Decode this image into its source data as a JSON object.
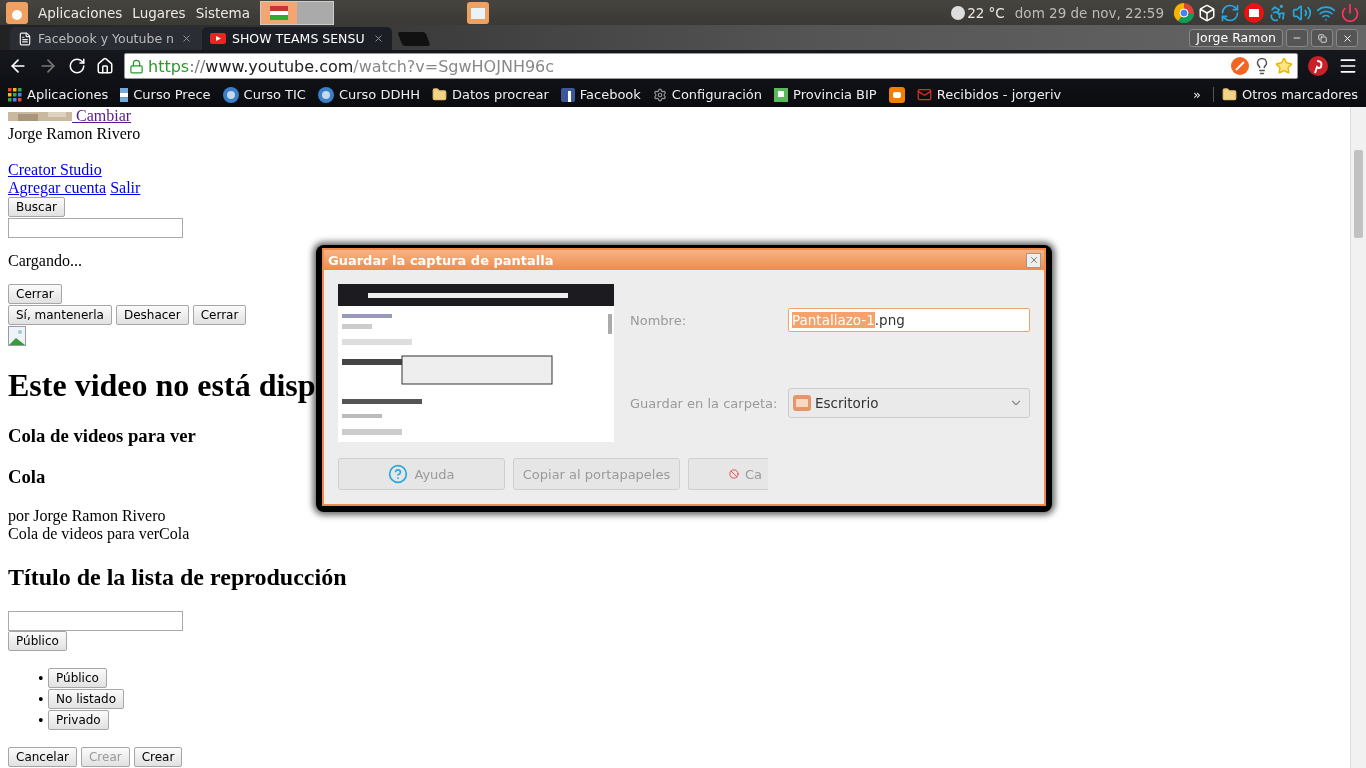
{
  "top_panel": {
    "menus": [
      "Aplicaciones",
      "Lugares",
      "Sistema"
    ],
    "weather": "22 °C",
    "clock": "dom 29 de nov, 22:59"
  },
  "browser": {
    "tabs": [
      {
        "title": "Facebook y Youtube n",
        "selected": false,
        "kind": "page"
      },
      {
        "title": "SHOW TEAMS SENSU",
        "selected": true,
        "kind": "video"
      }
    ],
    "user": "Jorge Ramon",
    "url": {
      "scheme": "https",
      "separator": "://",
      "host": "www.youtube.com",
      "path": "/watch?v=SgwHOJNH96c"
    },
    "bookmarks": [
      {
        "label": "Aplicaciones",
        "kind": "apps"
      },
      {
        "label": "Curso Prece",
        "kind": "flag"
      },
      {
        "label": "Curso TIC",
        "kind": "ar"
      },
      {
        "label": "Curso DDHH",
        "kind": "ar"
      },
      {
        "label": "Datos procrear",
        "kind": "folder"
      },
      {
        "label": "Facebook",
        "kind": "fb"
      },
      {
        "label": "Configuración",
        "kind": "gear"
      },
      {
        "label": "Provincia BIP",
        "kind": "p"
      },
      {
        "kind": "blog"
      },
      {
        "label": "Recibidos - jorgeriv",
        "kind": "mail"
      }
    ],
    "bookmarks_more": "»",
    "other_bookmarks": "Otros marcadores"
  },
  "page": {
    "blocks": [
      {
        "kind": "avatar_link",
        "label": " Cambiar"
      },
      {
        "kind": "text",
        "text": "Jorge Ramon Rivero"
      },
      {
        "kind": "break"
      },
      {
        "kind": "links",
        "items": [
          "Creator Studio"
        ]
      },
      {
        "kind": "links",
        "items": [
          "Agregar cuenta",
          "Salir"
        ]
      },
      {
        "kind": "buttons",
        "items": [
          {
            "label": "Buscar",
            "disabled": false
          }
        ]
      },
      {
        "kind": "input"
      },
      {
        "kind": "paragraph",
        "text": "Cargando..."
      },
      {
        "kind": "buttons",
        "items": [
          {
            "label": "Cerrar",
            "disabled": false
          }
        ]
      },
      {
        "kind": "buttons",
        "items": [
          {
            "label": "Sí, mantenerla",
            "disabled": false
          },
          {
            "label": "Deshacer",
            "disabled": false
          },
          {
            "label": "Cerrar",
            "disabled": false
          }
        ]
      },
      {
        "kind": "broken_image"
      },
      {
        "kind": "h1",
        "text": "Este video no está disp"
      },
      {
        "kind": "h3",
        "text": "Cola de videos para ver"
      },
      {
        "kind": "h3",
        "text": "Cola"
      },
      {
        "kind": "text",
        "text": "por Jorge Ramon Rivero"
      },
      {
        "kind": "text",
        "text": "Cola de videos para verCola"
      },
      {
        "kind": "h2",
        "text": "Título de la lista de reproducción"
      },
      {
        "kind": "input"
      },
      {
        "kind": "buttons",
        "items": [
          {
            "label": "Público",
            "disabled": false
          }
        ]
      },
      {
        "kind": "bullets",
        "items": [
          {
            "marker": "•",
            "label": "Público"
          },
          {
            "marker": "•",
            "label": "No listado"
          },
          {
            "marker": "•",
            "label": "Privado"
          }
        ]
      },
      {
        "kind": "buttons",
        "items": [
          {
            "label": "Cancelar",
            "disabled": false
          },
          {
            "label": "Crear",
            "disabled": true
          },
          {
            "label": "Crear",
            "disabled": false
          }
        ]
      }
    ]
  },
  "dialog": {
    "title": "Guardar la captura de pantalla",
    "name_label": "Nombre:",
    "name_selected": "Pantallazo-1",
    "name_rest": ".png",
    "folder_label": "Guardar en la carpeta:",
    "folder": "Escritorio",
    "buttons": [
      {
        "label": "Ayuda",
        "kind": "help"
      },
      {
        "label": "Copiar al portapapeles",
        "kind": "plain"
      },
      {
        "label": "Ca",
        "kind": "cancel"
      }
    ]
  }
}
